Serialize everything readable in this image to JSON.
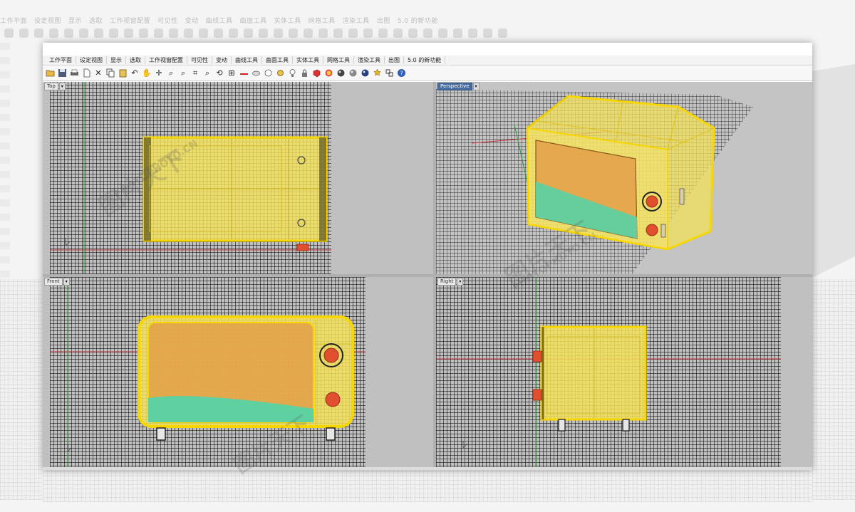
{
  "menu_tabs": [
    "工作平面",
    "设定视图",
    "显示",
    "选取",
    "工作视窗配置",
    "可见性",
    "变动",
    "曲线工具",
    "曲面工具",
    "实体工具",
    "网格工具",
    "渲染工具",
    "出图",
    "5.0 的新功能"
  ],
  "toolbar_icons": [
    "open-file-icon",
    "save-icon",
    "print-icon",
    "new-file-icon",
    "cut-icon",
    "copy-icon",
    "paste-icon",
    "undo-icon",
    "pan-hand-icon",
    "move-icon",
    "zoom-icon",
    "zoom-window-icon",
    "zoom-extents-icon",
    "zoom-selected-icon",
    "rotate-view-icon",
    "four-viewports-icon",
    "cplane-icon",
    "hide-icon",
    "show-icon",
    "snap-icon",
    "lock-icon",
    "light-bulb-icon",
    "shaded-icon",
    "rendered-icon",
    "material-icon",
    "sphere-icon",
    "render-icon",
    "settings-icon",
    "options-icon",
    "help-icon"
  ],
  "viewports": {
    "top": {
      "name": "Top"
    },
    "perspective": {
      "name": "Perspective"
    },
    "front": {
      "name": "Front"
    },
    "right": {
      "name": "Right"
    }
  },
  "watermark": {
    "text": "PHOTOPHOTO.CN",
    "cjk": "图片天下"
  },
  "colors": {
    "object_yellow": "#f3e25a",
    "object_outline": "#f7d600",
    "door_orange": "#e3a24a",
    "glass_green": "#5fd0a0",
    "knob_red": "#e0502e",
    "grid_bg": "#c0c0c0",
    "active_viewport_tab": "#4a6e9e"
  }
}
